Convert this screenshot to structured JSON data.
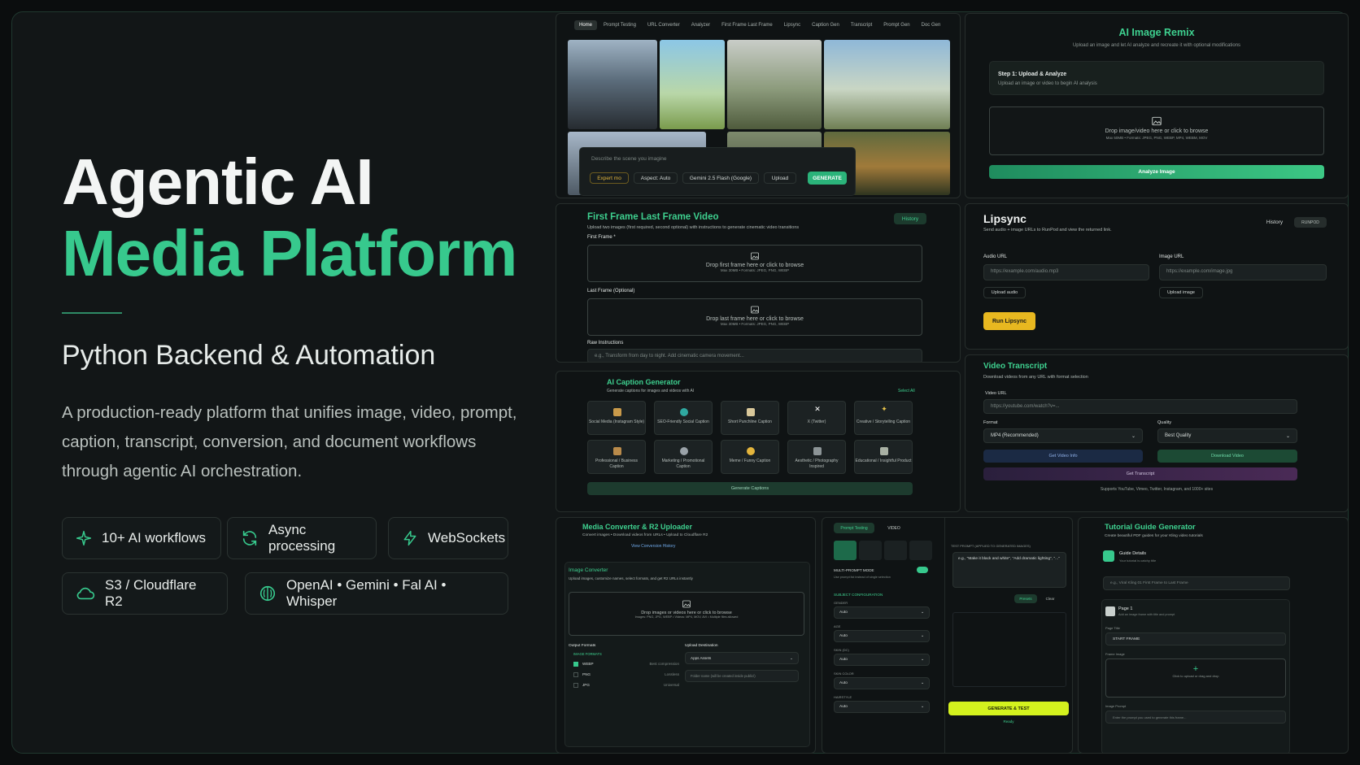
{
  "hero": {
    "title_line1": "Agentic AI",
    "title_line2": "Media Platform",
    "subtitle": "Python Backend & Automation",
    "description": "A production-ready platform that unifies image, video, prompt, caption, transcript, conversion, and document workflows through agentic AI orchestration."
  },
  "features": [
    {
      "label": "10+ AI workflows",
      "icon": "sparkle-icon"
    },
    {
      "label": "Async processing",
      "icon": "refresh-icon"
    },
    {
      "label": "WebSockets",
      "icon": "lightning-icon"
    },
    {
      "label": "S3 / Cloudflare R2",
      "icon": "cloud-icon"
    },
    {
      "label": "OpenAI  •  Gemini  •  Fal AI  •  Whisper",
      "icon": "brain-icon"
    }
  ],
  "home": {
    "tabs": [
      "Home",
      "Prompt Testing",
      "URL Converter",
      "Analyzer",
      "First Frame Last Frame",
      "Lipsync",
      "Caption Gen",
      "Transcript",
      "Prompt Gen",
      "Doc Gen"
    ],
    "prompt_placeholder": "Describe the scene you imagine",
    "expert_btn": "Expert mo",
    "aspect": "Aspect: Auto",
    "model": "Gemini 2.5 Flash (Google)",
    "upload": "Upload",
    "generate": "GENERATE"
  },
  "remix": {
    "title": "AI Image Remix",
    "subtitle": "Upload an image and let AI analyze and recreate it with optional modifications",
    "step_title": "Step 1: Upload & Analyze",
    "step_sub": "Upload an image or video to begin AI analysis",
    "drop": "Drop image/video here or click to browse",
    "drop_hint": "Max 50MB • Formats: JPEG, PNG, WEBP, MP4, WEBM, MOV",
    "button": "Analyze Image"
  },
  "fflf": {
    "title": "First Frame Last Frame Video",
    "subtitle": "Upload two images (first required, second optional) with instructions to generate cinematic video transitions",
    "history": "History",
    "first_label": "First Frame *",
    "first_drop": "Drop first frame here or click to browse",
    "last_label": "Last Frame (Optional)",
    "last_drop": "Drop last frame here or click to browse",
    "drop_hint": "Max 30MB • Formats: JPEG, PNG, WEBP",
    "raw_label": "Raw Instructions",
    "raw_placeholder": "e.g., Transform from day to night. Add cinematic camera movement..."
  },
  "lipsync": {
    "title": "Lipsync",
    "subtitle": "Send audio + image URLs to RunPod and view the returned link.",
    "history": "History",
    "runpod": "RUNPOD",
    "audio_label": "Audio URL",
    "audio_placeholder": "https://example.com/audio.mp3",
    "audio_upload": "Upload audio",
    "image_label": "Image URL",
    "image_placeholder": "https://example.com/image.jpg",
    "image_upload": "Upload image",
    "run": "Run Lipsync"
  },
  "caption": {
    "title": "AI Caption Generator",
    "subtitle": "Generate captions for images and videos with AI",
    "select_all": "Select All",
    "cards": [
      "Social Media (Instagram Style)",
      "SEO-Friendly Social Caption",
      "Short Punchline Caption",
      "X (Twitter)",
      "Creative / Storytelling Caption",
      "Professional / Business Caption",
      "Marketing / Promotional Caption",
      "Meme / Funny Caption",
      "Aesthetic / Photography Inspired",
      "Educational / Insightful Product"
    ],
    "button": "Generate Captions"
  },
  "transcript": {
    "title": "Video Transcript",
    "subtitle": "Download videos from any URL with format selection",
    "url_label": "Video URL",
    "url_placeholder": "https://youtube.com/watch?v=...",
    "format_label": "Format",
    "format_value": "MP4 (Recommended)",
    "quality_label": "Quality",
    "quality_value": "Best Quality",
    "info_btn": "Get Video Info",
    "download_btn": "Download Video",
    "transcript_btn": "Get Transcript",
    "footer": "Supports YouTube, Vimeo, Twitter, Instagram, and 1000+ sites"
  },
  "converter": {
    "title": "Media Converter & R2 Uploader",
    "subtitle": "Convert images • Download videos from URLs • Upload to Cloudflare R2",
    "history": "View Conversion History",
    "section": "Image Converter",
    "section_sub": "Upload images, customize names, select formats, and get R2 URLs instantly",
    "drop": "Drop images or videos here or click to browse",
    "drop_hint": "Images: PNG, JPG, WEBP • Videos: MP4, MOV, AVI • Multiple files allowed",
    "formats_label": "Output Formats",
    "formats_sub": "IMAGE FORMATS",
    "formats": [
      {
        "name": "WEBP",
        "note": "Best compression"
      },
      {
        "name": "PNG",
        "note": "Lossless"
      },
      {
        "name": "JPG",
        "note": "Universal"
      }
    ],
    "dest_label": "Upload Destination",
    "dest_value": "Apps Assets",
    "folder_placeholder": "Folder name (will be created inside public/)"
  },
  "prompt_testing": {
    "tab1": "Prompt Testing",
    "tab2": "VIDEO",
    "multi": "MULTI-PROMPT MODE",
    "multi_sub": "Use prompt list instead of single selection",
    "test_label": "TEST PROMPT (APPLIED TO GENERATED IMAGES)",
    "test_text": "e.g., \"Make it black and white\", \"Add dramatic lighting\", \"...\"",
    "presets": "Presets",
    "clear": "Clear",
    "subject": "SUBJECT CONFIGURATION",
    "fields": [
      {
        "label": "GENDER",
        "value": "Auto"
      },
      {
        "label": "AGE",
        "value": "Auto"
      },
      {
        "label": "SKIN (DC)",
        "value": "Auto"
      },
      {
        "label": "SKIN COLOR",
        "value": "Auto"
      },
      {
        "label": "HAIRSTYLE",
        "value": "Auto"
      }
    ],
    "generate": "GENERATE & TEST",
    "ready": "Ready"
  },
  "tutorial": {
    "title": "Tutorial Guide Generator",
    "subtitle": "Create beautiful PDF guides for your Kling video tutorials",
    "details": "Guide Details",
    "details_sub": "Your tutorial is catchy title",
    "title_placeholder": "e.g., Viral Kling 01 First Frame to Last Frame",
    "page": "Page 1",
    "page_sub": "Add an image frame with title and prompt",
    "page_title_label": "Page Title",
    "page_title_value": "START FRAME",
    "frame_label": "Frame Image",
    "frame_drop": "Click to upload or drag and drop",
    "prompt_label": "Image Prompt",
    "prompt_placeholder": "Enter the prompt you used to generate this frame..."
  },
  "colors": {
    "accent": "#37c98d",
    "background": "#0b0d0e",
    "yellow": "#e8b820",
    "lime": "#d4f21e"
  }
}
